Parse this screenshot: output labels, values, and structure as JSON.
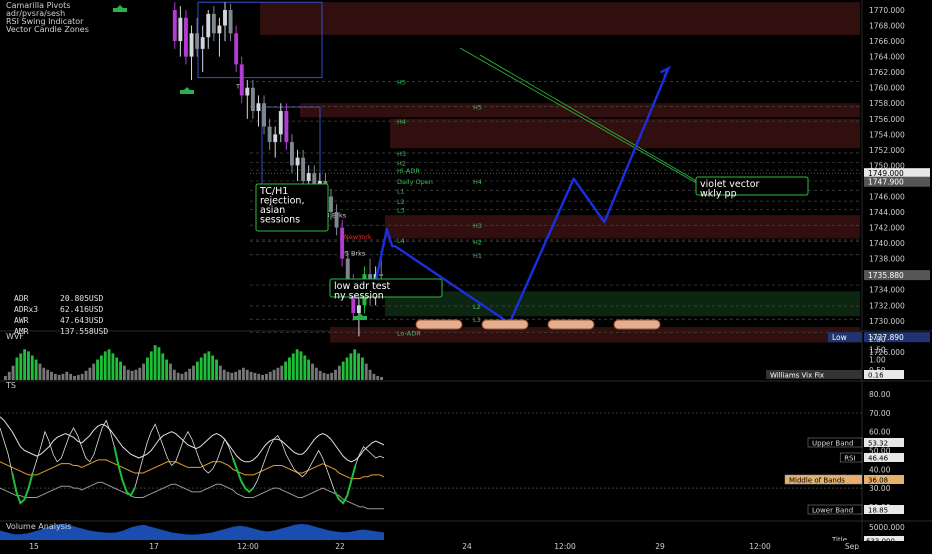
{
  "colors": {
    "background": "#000000",
    "up_candle": "#cfd6dc",
    "down_candle": "#7e8790",
    "vector_green": "#1fbf3a",
    "vector_violet": "#b23cd1",
    "projection": "#1a2fe0",
    "trendline": "#2bbf3a",
    "pivot_text": "#39c05a",
    "zone_red": "#3a1212",
    "zone_green": "#0e2d14",
    "ts_white": "#e0e0e0",
    "ts_orange": "#e0a030",
    "ts_gray": "#9a9a9a",
    "volume": "#1d5ccf",
    "wvf_green": "#1fbf3a",
    "wvf_gray": "#777777"
  },
  "legend": [
    "Camarilla Pivots",
    "adr/pvsra/sesh",
    "RSI Swing Indicator",
    "Vector Candle Zones"
  ],
  "adr_stats": [
    {
      "label": "ADR",
      "value": "20.805USD"
    },
    {
      "label": "ADRx3",
      "value": "62.416USD"
    },
    {
      "label": "AWR",
      "value": "47.643USD"
    },
    {
      "label": "AMR",
      "value": "137.558USD"
    }
  ],
  "chart_data": [
    {
      "type": "candlestick",
      "title": "",
      "yaxis_ticks": [
        "1770.000",
        "1768.000",
        "1766.000",
        "1764.000",
        "1762.000",
        "1760.000",
        "1758.000",
        "1756.000",
        "1754.000",
        "1752.000",
        "1750.000",
        "1748.000",
        "1746.000",
        "1744.000",
        "1742.000",
        "1740.000",
        "1738.000",
        "1736.000",
        "1734.000",
        "1732.000",
        "1730.000",
        "1728.000",
        "1726.000"
      ],
      "ylim": [
        1725.2,
        1771.2
      ],
      "price_labels": [
        {
          "text": "1749.000",
          "price": 1749.0,
          "style": "white"
        },
        {
          "text": "1747.900",
          "price": 1747.9,
          "style": "gray"
        },
        {
          "text": "1735.880",
          "price": 1735.88,
          "style": "gray"
        },
        {
          "text": "Low",
          "price": 1727.89,
          "style": "blue"
        },
        {
          "text": "1727.890",
          "price": 1727.89,
          "style": "blue"
        }
      ],
      "pivot_labels": [
        {
          "text": "H5",
          "price": 1760.8,
          "col": 1
        },
        {
          "text": "H5",
          "price": 1757.6,
          "col": 2
        },
        {
          "text": "H4",
          "price": 1755.7,
          "col": 1
        },
        {
          "text": "H3",
          "price": 1751.6,
          "col": 1
        },
        {
          "text": "H2",
          "price": 1750.4,
          "col": 1
        },
        {
          "text": "Hi-ADR",
          "price": 1749.4,
          "col": 1
        },
        {
          "text": "Daily Open",
          "price": 1748.0,
          "col": 1
        },
        {
          "text": "H4",
          "price": 1748.0,
          "col": 2
        },
        {
          "text": "L1",
          "price": 1746.8,
          "col": 1
        },
        {
          "text": "L2",
          "price": 1745.4,
          "col": 1
        },
        {
          "text": "L3",
          "price": 1744.3,
          "col": 1
        },
        {
          "text": "H3",
          "price": 1742.3,
          "col": 2
        },
        {
          "text": "L4",
          "price": 1740.4,
          "col": 1
        },
        {
          "text": "H2",
          "price": 1740.2,
          "col": 2
        },
        {
          "text": "H1",
          "price": 1738.5,
          "col": 2
        },
        {
          "text": "L5",
          "price": 1734.6,
          "col": 1
        },
        {
          "text": "L2",
          "price": 1731.9,
          "col": 2
        },
        {
          "text": "L3",
          "price": 1730.2,
          "col": 2
        },
        {
          "text": "Lo-ADR",
          "price": 1728.5,
          "col": 1
        }
      ],
      "session_labels": [
        {
          "text": "TC",
          "price": 1760.3
        },
        {
          "text": "L3 Brks",
          "price": 1743.7
        },
        {
          "text": "NewYork",
          "price": 1740.9
        },
        {
          "text": "US Brks",
          "price": 1738.8
        }
      ],
      "annotations": [
        {
          "id": "tc",
          "text": "TC/H1 rejection, asian sessions",
          "lines": [
            "TC/H1",
            "rejection,",
            "asian",
            "sessions"
          ]
        },
        {
          "id": "adr",
          "text": "low adr test ny session",
          "lines": [
            "low adr test",
            "ny session"
          ]
        },
        {
          "id": "violet",
          "text": "violet vector wkly pp",
          "lines": [
            "violet vector",
            "wkly pp"
          ]
        }
      ],
      "candles": [
        [
          1770,
          1771,
          1765,
          1766
        ],
        [
          1766,
          1770.5,
          1764,
          1769
        ],
        [
          1769,
          1770,
          1763,
          1764
        ],
        [
          1764,
          1768,
          1761,
          1767
        ],
        [
          1767,
          1769,
          1764,
          1765
        ],
        [
          1765,
          1768,
          1762,
          1766.5
        ],
        [
          1766.5,
          1770,
          1765,
          1769.5
        ],
        [
          1769.5,
          1770.5,
          1766,
          1767
        ],
        [
          1767,
          1769,
          1764,
          1768
        ],
        [
          1768,
          1771,
          1766,
          1770
        ],
        [
          1770,
          1770.8,
          1766,
          1767
        ],
        [
          1767,
          1768,
          1762,
          1763
        ],
        [
          1763,
          1764,
          1758,
          1759
        ],
        [
          1759,
          1761,
          1756,
          1760
        ],
        [
          1760,
          1761,
          1756,
          1757
        ],
        [
          1757,
          1759,
          1755,
          1758
        ],
        [
          1758,
          1759,
          1754,
          1755
        ],
        [
          1755,
          1756,
          1752,
          1753
        ],
        [
          1753,
          1755,
          1751,
          1754
        ],
        [
          1754,
          1758,
          1753,
          1757
        ],
        [
          1757,
          1758,
          1752,
          1753
        ],
        [
          1753,
          1754,
          1749,
          1750
        ],
        [
          1750,
          1752,
          1748,
          1751
        ],
        [
          1751,
          1752,
          1747,
          1748
        ],
        [
          1748,
          1750,
          1746,
          1749
        ],
        [
          1749,
          1750,
          1746,
          1747
        ],
        [
          1747,
          1749,
          1745,
          1748
        ],
        [
          1748,
          1749,
          1745,
          1746
        ],
        [
          1746,
          1747,
          1743,
          1744
        ],
        [
          1744,
          1745,
          1741,
          1742
        ],
        [
          1742,
          1743,
          1737,
          1738
        ],
        [
          1738,
          1739,
          1734,
          1735
        ],
        [
          1735,
          1736,
          1730,
          1731
        ],
        [
          1731,
          1733,
          1728,
          1732
        ],
        [
          1732,
          1737,
          1731,
          1736
        ],
        [
          1736,
          1738,
          1732,
          1733
        ],
        [
          1733,
          1737,
          1732,
          1736
        ],
        [
          1736,
          1739,
          1734,
          1735.8
        ]
      ],
      "projection": [
        {
          "bar": 36.5,
          "price": 1735.0
        },
        {
          "bar": 38.5,
          "price": 1741.8
        },
        {
          "bar": 39.5,
          "price": 1739.6
        },
        {
          "bar": 40.0,
          "price": 1739.6
        },
        {
          "bar": 60.5,
          "price": 1729.7
        },
        {
          "bar": 72.0,
          "price": 1748.3
        },
        {
          "bar": 77.5,
          "price": 1742.7
        },
        {
          "bar": 89.0,
          "price": 1762.5
        }
      ],
      "time_ticks": [
        "15",
        "17",
        "12:00",
        "22",
        "24",
        "12:00",
        "29",
        "12:00",
        "Sep"
      ],
      "round_markers": 4
    },
    {
      "type": "bar",
      "title": "WVF",
      "yaxis_ticks": [
        "2.00",
        "1.50",
        "1.00",
        "0.50"
      ],
      "ylim": [
        0,
        2.2
      ],
      "value_label": {
        "name": "Williams Vix Fix",
        "value": "0.16"
      },
      "values": [
        0.2,
        0.4,
        0.7,
        1.1,
        1.3,
        1.5,
        1.4,
        1.2,
        1.0,
        0.8,
        0.6,
        0.5,
        0.4,
        0.3,
        0.25,
        0.3,
        0.4,
        0.3,
        0.2,
        0.25,
        0.3,
        0.45,
        0.6,
        0.8,
        1.0,
        1.2,
        1.4,
        1.5,
        1.3,
        1.1,
        0.9,
        0.7,
        0.5,
        0.45,
        0.5,
        0.6,
        0.8,
        1.1,
        1.4,
        1.7,
        1.6,
        1.3,
        1.0,
        0.8,
        0.5,
        0.35,
        0.3,
        0.4,
        0.55,
        0.7,
        0.9,
        1.1,
        1.3,
        1.4,
        1.2,
        1.0,
        0.7,
        0.5,
        0.4,
        0.35,
        0.4,
        0.5,
        0.6,
        0.5,
        0.4,
        0.35,
        0.3,
        0.25,
        0.3,
        0.4,
        0.5,
        0.6,
        0.7,
        0.9,
        1.1,
        1.3,
        1.5,
        1.4,
        1.2,
        1.0,
        0.8,
        0.6,
        0.45,
        0.35,
        0.3,
        0.35,
        0.5,
        0.7,
        0.9,
        1.1,
        1.3,
        1.5,
        1.3,
        1.1,
        0.8,
        0.5,
        0.3,
        0.2,
        0.15
      ],
      "green_threshold": 0.9
    },
    {
      "type": "line",
      "title": "TS",
      "yaxis_ticks": [
        "80.00",
        "70.00",
        "60.00",
        "50.00",
        "40.00",
        "30.00",
        "20.00"
      ],
      "ylim": [
        13,
        87
      ],
      "value_labels": [
        {
          "name": "Upper Band",
          "value": "53.32",
          "style": "white"
        },
        {
          "name": "RSI",
          "value": "46.46",
          "style": "white"
        },
        {
          "name": "Middle of Bands",
          "value": "36.08",
          "style": "orange"
        },
        {
          "name": "Lower Band",
          "value": "18.85",
          "style": "white"
        }
      ],
      "series": [
        {
          "style": "ts_white",
          "values": [
            68,
            66,
            63,
            60,
            56,
            52,
            50,
            49,
            48,
            47,
            48,
            50,
            52,
            55,
            57,
            58,
            59,
            58,
            57,
            55,
            54,
            56,
            58,
            61,
            63,
            64,
            63,
            61,
            58,
            55,
            52,
            50,
            48,
            47,
            46,
            47,
            48,
            50,
            53,
            56,
            58,
            59,
            60,
            59,
            57,
            55,
            53,
            52,
            51,
            52,
            54,
            56,
            58,
            59,
            58,
            56,
            53,
            50,
            47,
            45,
            44,
            44,
            45,
            47,
            50,
            53,
            55,
            56,
            56,
            55,
            53,
            51,
            49,
            48,
            48,
            50,
            53,
            56,
            58,
            59,
            58,
            56,
            53,
            50,
            47,
            45,
            44,
            45,
            47,
            50,
            52,
            54,
            55,
            54,
            53
          ]
        },
        {
          "style": "ts_orange",
          "values": [
            44,
            43,
            42,
            41,
            40,
            39,
            38,
            37,
            37,
            37,
            38,
            39,
            40,
            41,
            42,
            43,
            43,
            43,
            42,
            42,
            41,
            42,
            43,
            44,
            45,
            45,
            45,
            44,
            43,
            42,
            41,
            40,
            39,
            38,
            38,
            38,
            39,
            40,
            41,
            42,
            43,
            44,
            44,
            44,
            43,
            42,
            41,
            41,
            41,
            41,
            42,
            43,
            44,
            44,
            44,
            43,
            42,
            40,
            39,
            38,
            37,
            37,
            37,
            38,
            39,
            40,
            41,
            42,
            42,
            42,
            41,
            40,
            39,
            38,
            38,
            39,
            40,
            41,
            42,
            43,
            42,
            41,
            40,
            38,
            37,
            36,
            35,
            35,
            35,
            36,
            36,
            37,
            37,
            37,
            36
          ]
        },
        {
          "style": "ts_gray",
          "values": [
            30,
            29,
            28,
            27,
            26,
            26,
            25,
            25,
            25,
            25,
            26,
            27,
            28,
            29,
            30,
            31,
            31,
            31,
            30,
            30,
            29,
            30,
            31,
            32,
            33,
            33,
            32,
            31,
            30,
            29,
            28,
            27,
            26,
            25,
            25,
            25,
            26,
            27,
            28,
            29,
            30,
            31,
            32,
            32,
            31,
            30,
            29,
            28,
            28,
            28,
            29,
            30,
            31,
            32,
            32,
            31,
            30,
            29,
            27,
            26,
            25,
            25,
            25,
            26,
            27,
            28,
            29,
            30,
            30,
            29,
            28,
            27,
            26,
            25,
            25,
            26,
            27,
            28,
            29,
            30,
            29,
            28,
            27,
            26,
            24,
            23,
            22,
            21,
            20,
            20,
            19,
            19,
            19,
            19,
            19
          ]
        },
        {
          "style": "ts_white",
          "values": [
            62,
            55,
            48,
            38,
            28,
            22,
            24,
            30,
            38,
            45,
            52,
            60,
            55,
            48,
            44,
            46,
            52,
            58,
            62,
            58,
            52,
            46,
            44,
            48,
            55,
            62,
            66,
            60,
            52,
            42,
            34,
            28,
            26,
            30,
            38,
            46,
            54,
            60,
            64,
            58,
            52,
            46,
            42,
            44,
            50,
            56,
            60,
            56,
            50,
            44,
            40,
            38,
            40,
            44,
            50,
            56,
            52,
            46,
            40,
            34,
            30,
            28,
            30,
            34,
            40,
            46,
            52,
            56,
            58,
            54,
            48,
            44,
            40,
            38,
            36,
            38,
            42,
            46,
            50,
            46,
            40,
            34,
            28,
            24,
            22,
            26,
            34,
            42,
            48,
            52,
            50,
            48,
            46,
            47,
            46
          ]
        }
      ],
      "green_segments": [
        [
          3,
          8
        ],
        [
          28,
          33
        ],
        [
          57,
          62
        ],
        [
          82,
          87
        ]
      ]
    },
    {
      "type": "area",
      "title": "Volume Analysis",
      "yaxis_ticks": [
        "5000.000"
      ],
      "value_label": {
        "name": "Title",
        "value": "633.000"
      },
      "values": [
        0.5,
        0.4,
        0.3,
        0.3,
        0.35,
        0.45,
        0.55,
        0.7,
        0.8,
        0.85,
        0.8,
        0.7,
        0.6,
        0.5,
        0.45,
        0.4,
        0.38,
        0.4,
        0.5,
        0.65,
        0.75,
        0.8,
        0.7,
        0.6,
        0.5,
        0.4,
        0.35,
        0.3,
        0.28,
        0.3,
        0.35,
        0.4,
        0.5,
        0.6,
        0.7,
        0.75,
        0.7,
        0.6,
        0.5,
        0.45,
        0.5,
        0.6,
        0.7,
        0.8,
        0.85,
        0.8,
        0.7,
        0.6,
        0.5,
        0.45,
        0.4,
        0.42,
        0.5,
        0.55,
        0.5,
        0.45,
        0.4
      ]
    }
  ]
}
